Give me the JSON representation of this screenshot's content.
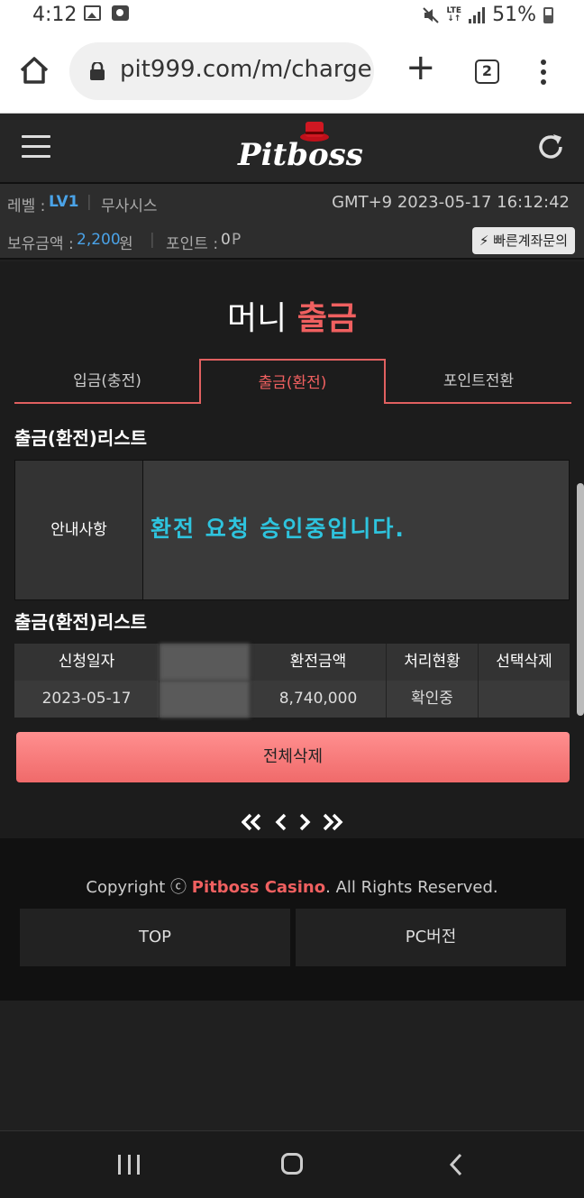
{
  "status_bar": {
    "time": "4:12",
    "network": "LTE",
    "battery": "51%",
    "icons": [
      "image-icon",
      "clock-icon",
      "mute-icon",
      "signal-icon",
      "battery-icon"
    ]
  },
  "browser": {
    "url": "pit999.com/m/charge",
    "tab_count": "2"
  },
  "site_header": {
    "logo_text": "Pitboss"
  },
  "user_info": {
    "level_label": "레벨 : ",
    "level_value": "LV1",
    "username": "무사시스",
    "datetime": "GMT+9 2023-05-17 16:12:42",
    "balance_label": "보유금액 : ",
    "balance_value": "2,200",
    "balance_unit": " 원",
    "point_label": "포인트 : ",
    "point_value": "0",
    "point_unit": " P",
    "fast_inquiry_button": "빠른계좌문의"
  },
  "page": {
    "title_prefix": "머니 ",
    "title_highlight": "출금",
    "tabs": [
      {
        "label": "입금(충전)"
      },
      {
        "label": "출금(환전)"
      },
      {
        "label": "포인트전환"
      }
    ],
    "section1_title": "출금(환전)리스트",
    "notice_label": "안내사항",
    "notice_text": "환전 요청 승인중입니다.",
    "section2_title": "출금(환전)리스트",
    "table": {
      "headers": [
        "신청일자",
        "",
        "환전금액",
        "처리현황",
        "선택삭제"
      ],
      "rows": [
        {
          "date": "2023-05-17",
          "hidden": "",
          "amount": "8,740,000",
          "status": "확인중",
          "delete": ""
        }
      ]
    },
    "delete_all_button": "전체삭제"
  },
  "footer": {
    "copyright_prefix": "Copyright ⓒ ",
    "copyright_brand": "Pitboss Casino",
    "copyright_suffix": ". All Rights Reserved.",
    "top_button": "TOP",
    "pc_button": "PC버전"
  },
  "colors": {
    "accent_red": "#f06060",
    "notice_cyan": "#2ec4de",
    "level_blue": "#4aa3e8"
  }
}
